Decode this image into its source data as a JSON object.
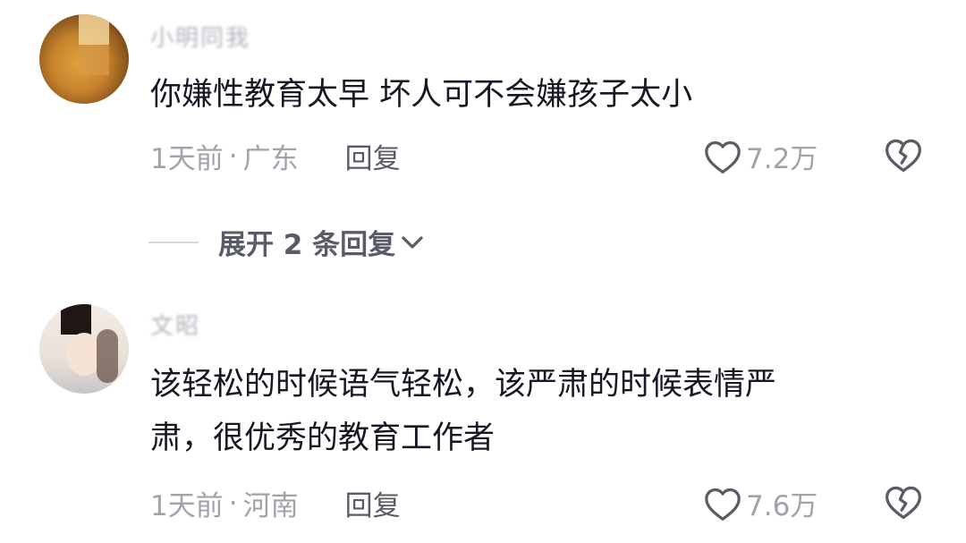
{
  "comments": [
    {
      "username": "小明同我",
      "text": "你嫌性教育太早 坏人可不会嫌孩子太小",
      "time": "1天前",
      "separator": "·",
      "location": "广东",
      "reply_label": "回复",
      "likes": "7.2万"
    },
    {
      "username": "文昭",
      "text_line1": "该轻松的时候语气轻松，该严肃的时候表情严",
      "text_line2": "肃，很优秀的教育工作者",
      "time": "1天前",
      "separator": "·",
      "location": "河南",
      "reply_label": "回复",
      "likes": "7.6万"
    }
  ],
  "expand_replies": {
    "label": "展开 2 条回复"
  },
  "icons": {
    "like": "heart-outline-icon",
    "dislike": "broken-heart-icon",
    "expand": "chevron-down-icon"
  },
  "colors": {
    "text": "#161823",
    "meta": "#a0a3aa",
    "reply": "#595c66"
  }
}
